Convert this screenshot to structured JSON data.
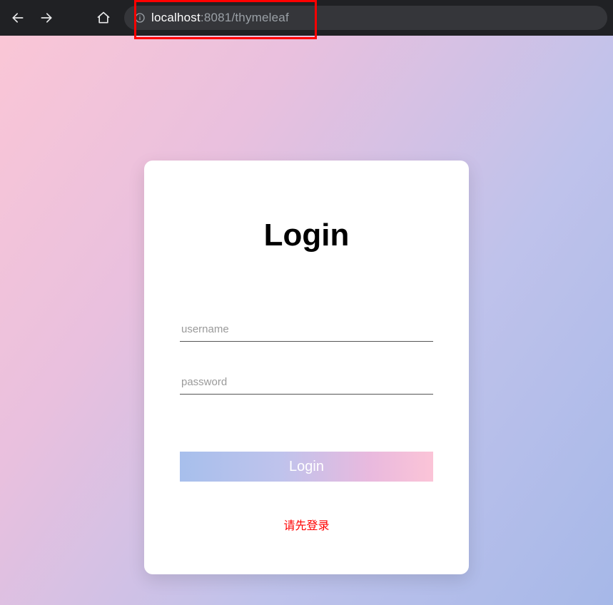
{
  "browser": {
    "url_host": "localhost",
    "url_port": ":8081",
    "url_path": "/thymeleaf"
  },
  "login": {
    "title": "Login",
    "username_placeholder": "username",
    "password_placeholder": "password",
    "submit_label": "Login",
    "message": "请先登录"
  },
  "annotation": {
    "highlight_color": "#ff0000"
  }
}
